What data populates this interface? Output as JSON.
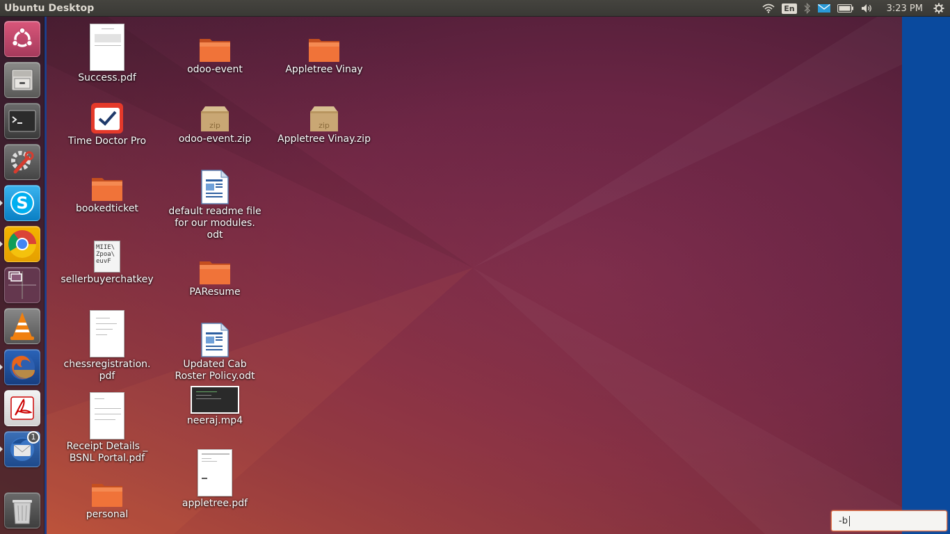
{
  "panel": {
    "title": "Ubuntu Desktop",
    "keyboard_layout": "En",
    "clock": "3:23 PM",
    "indicators": [
      "wifi-icon",
      "keyboard-layout",
      "bluetooth-icon",
      "mail-icon",
      "battery-icon",
      "volume-icon",
      "clock",
      "session-gear-icon"
    ]
  },
  "launcher": {
    "items": [
      {
        "name": "dash-home",
        "icon": "ubuntu-logo-icon",
        "running": false
      },
      {
        "name": "files",
        "icon": "file-cabinet-icon",
        "running": false
      },
      {
        "name": "terminal",
        "icon": "terminal-icon",
        "running": false
      },
      {
        "name": "system-settings",
        "icon": "settings-wrench-icon",
        "running": false
      },
      {
        "name": "skype",
        "icon": "skype-icon",
        "running": true
      },
      {
        "name": "chrome",
        "icon": "chrome-icon",
        "running": true
      },
      {
        "name": "workspace-switcher",
        "icon": "workspace-icon",
        "running": false
      },
      {
        "name": "vlc",
        "icon": "vlc-cone-icon",
        "running": false
      },
      {
        "name": "firefox",
        "icon": "firefox-icon",
        "running": true
      },
      {
        "name": "adobe-reader",
        "icon": "acrobat-icon",
        "running": false
      },
      {
        "name": "thunderbird",
        "icon": "thunderbird-icon",
        "running": true,
        "badge": "1"
      },
      {
        "name": "trash",
        "icon": "trash-icon",
        "running": false
      }
    ]
  },
  "desktop": {
    "icons": [
      {
        "label": "Success.pdf",
        "type": "pdf"
      },
      {
        "label": "Time Doctor Pro",
        "type": "app"
      },
      {
        "label": "bookedticket",
        "type": "folder"
      },
      {
        "label": "sellerbuyerchatkey",
        "type": "text"
      },
      {
        "label": "chessregistration.\npdf",
        "type": "pdf"
      },
      {
        "label": "Receipt Details _\nBSNL Portal.pdf",
        "type": "pdf"
      },
      {
        "label": "personal",
        "type": "folder"
      },
      {
        "label": "odoo-event",
        "type": "folder"
      },
      {
        "label": "odoo-event.zip",
        "type": "zip"
      },
      {
        "label": "default readme file\nfor our modules.\nodt",
        "type": "odt"
      },
      {
        "label": "PAResume",
        "type": "folder"
      },
      {
        "label": "Updated Cab\nRoster Policy.odt",
        "type": "odt"
      },
      {
        "label": "neeraj.mp4",
        "type": "video"
      },
      {
        "label": "appletree.pdf",
        "type": "pdf"
      },
      {
        "label": "Appletree Vinay",
        "type": "folder"
      },
      {
        "label": "Appletree Vinay.zip",
        "type": "zip"
      }
    ]
  },
  "icon_text": {
    "zip": "zip",
    "text_preview": "MIIE\\\nZpoa\\\neuvF"
  },
  "rename_input": {
    "value": "-b"
  },
  "colors": {
    "panel": "#3a3935",
    "launcher_edge": "#1d3e8a",
    "right_strip": "#0a4a9e",
    "folder": "#f0703a",
    "input_border": "#e9774a"
  }
}
